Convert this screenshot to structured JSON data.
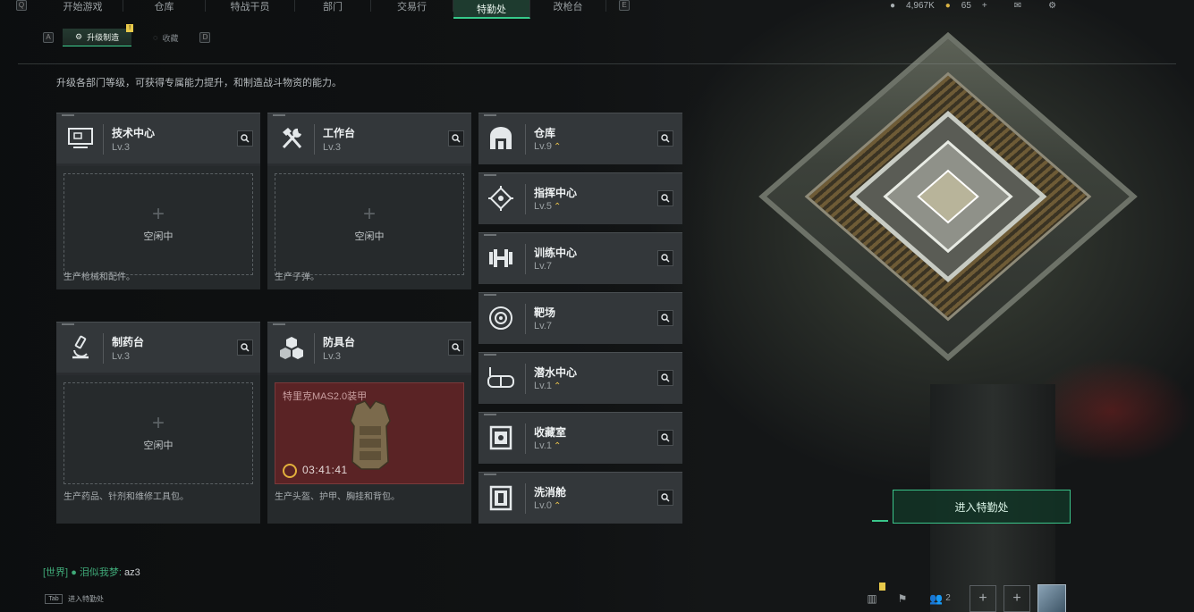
{
  "nav": {
    "left_key": "Q",
    "right_key": "E",
    "tabs": [
      "开始游戏",
      "仓库",
      "特战干员",
      "部门",
      "交易行",
      "特勤处",
      "改枪台"
    ],
    "active_index": 5
  },
  "currency": {
    "coins": "4,967K",
    "tickets": "65"
  },
  "subnav": {
    "left_key": "A",
    "right_key": "D",
    "tabs": [
      {
        "label": "升级制造",
        "active": true,
        "badge": "!"
      },
      {
        "label": "收藏",
        "active": false
      }
    ]
  },
  "intro": "升级各部门等级，可获得专属能力提升，和制造战斗物资的能力。",
  "workshops": [
    {
      "title": "技术中心",
      "level": "Lv.3",
      "state": "空闲中",
      "desc": "生产枪械和配件。",
      "icon": "monitor-icon"
    },
    {
      "title": "工作台",
      "level": "Lv.3",
      "state": "空闲中",
      "desc": "生产子弹。",
      "icon": "tools-icon"
    },
    {
      "title": "制药台",
      "level": "Lv.3",
      "state": "空闲中",
      "desc": "生产药品、针剂和维修工具包。",
      "icon": "microscope-icon"
    },
    {
      "title": "防具台",
      "level": "Lv.3",
      "crafting_item": "特里克MAS2.0装甲",
      "timer": "03:41:41",
      "desc": "生产头盔、护甲、胸挂和背包。",
      "icon": "blocks-icon"
    }
  ],
  "facilities": [
    {
      "title": "仓库",
      "level": "Lv.9",
      "upgradable": true,
      "icon": "vault-icon"
    },
    {
      "title": "指挥中心",
      "level": "Lv.5",
      "upgradable": true,
      "icon": "target-diamond-icon"
    },
    {
      "title": "训练中心",
      "level": "Lv.7",
      "upgradable": false,
      "icon": "dumbbell-icon"
    },
    {
      "title": "靶场",
      "level": "Lv.7",
      "upgradable": false,
      "icon": "crosshair-icon"
    },
    {
      "title": "潜水中心",
      "level": "Lv.1",
      "upgradable": true,
      "icon": "diving-mask-icon"
    },
    {
      "title": "收藏室",
      "level": "Lv.1",
      "upgradable": true,
      "icon": "display-case-icon"
    },
    {
      "title": "洗消舱",
      "level": "Lv.0",
      "upgradable": true,
      "icon": "decon-pod-icon"
    }
  ],
  "enter_button": "进入特勤处",
  "chat": {
    "channel": "[世界]",
    "name": "泪似我梦",
    "message": "az3"
  },
  "tab_hint": {
    "key": "Tab",
    "label": "进入特勤处"
  },
  "bottom": {
    "squad_count": "2"
  },
  "colors": {
    "accent": "#36c98a",
    "upgrade": "#e8c14a",
    "crafting_bg": "#5a2325"
  }
}
